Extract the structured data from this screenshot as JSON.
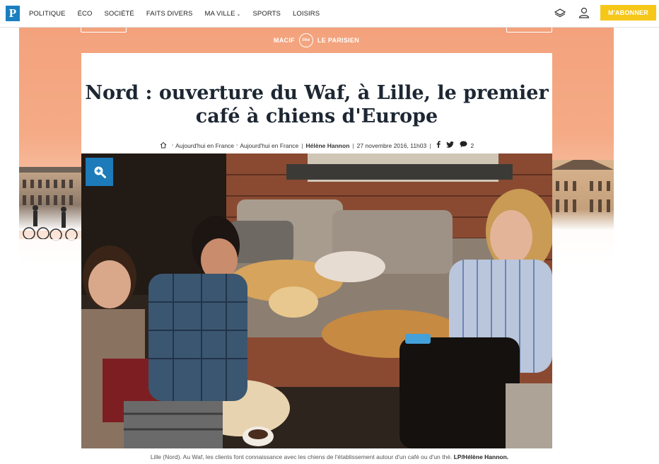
{
  "nav": {
    "logo": "P",
    "items": [
      {
        "label": "POLITIQUE"
      },
      {
        "label": "ÉCO"
      },
      {
        "label": "SOCIÉTÉ"
      },
      {
        "label": "FAITS DIVERS"
      },
      {
        "label": "MA VILLE",
        "has_dropdown": true
      },
      {
        "label": "SPORTS"
      },
      {
        "label": "LOISIRS"
      }
    ],
    "subscribe_label": "M'ABONNER",
    "icons": [
      "newspaper-icon",
      "user-icon"
    ]
  },
  "sponsor": {
    "left": "MACIF",
    "badge": "like",
    "right": "LE PARISIEN"
  },
  "article": {
    "title_line1": "Nord : ouverture du Waf, à Lille, le premier",
    "title_line2": "café à chiens d'Europe",
    "breadcrumb": [
      "Aujourd'hui en France",
      "Aujourd'hui en France"
    ],
    "author": "Hélène Hannon",
    "date": "27 novembre 2016, 11h03",
    "comment_count": "2",
    "caption": "Lille (Nord). Au Waf, les clients font connaissance avec les chiens de l'établissement autour d'un café ou d'un thé.",
    "credit": "LP/Hélène Hannon."
  },
  "colors": {
    "brand_blue": "#1a7fc0",
    "subscribe_yellow": "#f6c718",
    "sponsor_orange": "#f3a27c",
    "title_color": "#1d2733"
  }
}
